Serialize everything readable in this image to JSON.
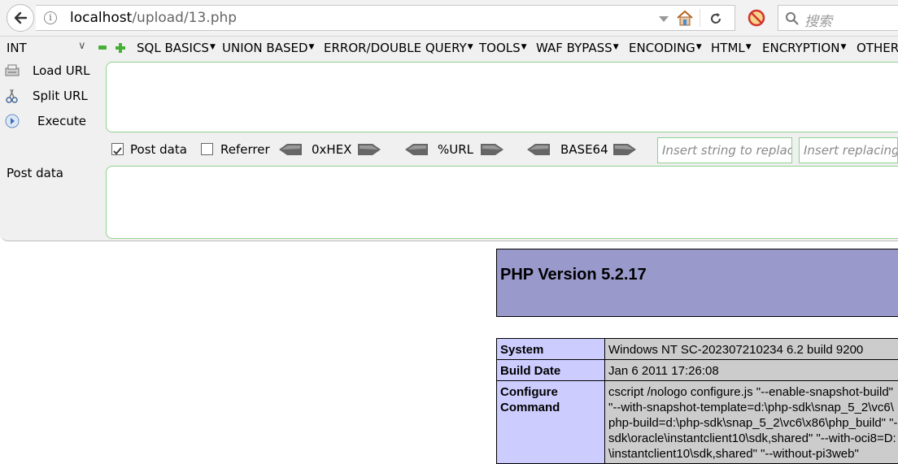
{
  "browser": {
    "url_host": "localhost",
    "url_path": "/upload/13.php",
    "search_placeholder": "搜索"
  },
  "hackbar": {
    "int_select": "INT",
    "menu": [
      {
        "label": "SQL BASICS"
      },
      {
        "label": "UNION BASED"
      },
      {
        "label": "ERROR/DOUBLE QUERY"
      },
      {
        "label": "TOOLS"
      },
      {
        "label": "WAF BYPASS"
      },
      {
        "label": "ENCODING"
      },
      {
        "label": "HTML"
      },
      {
        "label": "ENCRYPTION"
      },
      {
        "label": "OTHER"
      }
    ],
    "load_url": "Load URL",
    "split_url": "Split URL",
    "execute": "Execute",
    "post_data_check": "Post data",
    "referrer_check": "Referrer",
    "hex_label": "0xHEX",
    "url_label": "%URL",
    "base64_label": "BASE64",
    "replace_placeholder": "Insert string to replace",
    "replacing_placeholder": "Insert replacing",
    "post_data_label": "Post data",
    "post_data_checked": true,
    "referrer_checked": false
  },
  "phpinfo": {
    "title": "PHP Version 5.2.17",
    "rows": [
      {
        "key": "System",
        "value": "Windows NT SC-202307210234 6.2 build 9200"
      },
      {
        "key": "Build Date",
        "value": "Jan 6 2011 17:26:08"
      },
      {
        "key_lines": [
          "Configure",
          "Command"
        ],
        "value_lines": [
          "cscript /nologo configure.js \"--enable-snapshot-build\"",
          "\"--with-snapshot-template=d:\\php-sdk\\snap_5_2\\vc6\\",
          "php-build=d:\\php-sdk\\snap_5_2\\vc6\\x86\\php_build\" \"-",
          "sdk\\oracle\\instantclient10\\sdk,shared\" \"--with-oci8=D:",
          "\\instantclient10\\sdk,shared\" \"--without-pi3web\""
        ]
      }
    ]
  }
}
